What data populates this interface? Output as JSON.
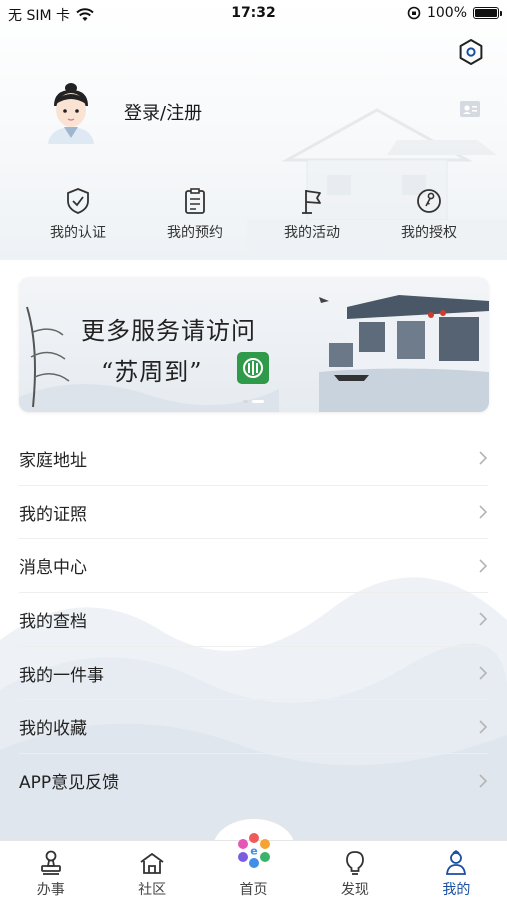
{
  "status_bar": {
    "carrier": "无 SIM 卡",
    "time": "17:32",
    "battery": "100%",
    "battery_level": 1.0
  },
  "profile": {
    "login_label": "登录/注册"
  },
  "quick_actions": [
    {
      "label": "我的认证",
      "icon": "shield-check-icon"
    },
    {
      "label": "我的预约",
      "icon": "clipboard-icon"
    },
    {
      "label": "我的活动",
      "icon": "flag-icon"
    },
    {
      "label": "我的授权",
      "icon": "key-icon"
    }
  ],
  "banner": {
    "line1": "更多服务请访问",
    "line2": "“苏周到”"
  },
  "menu": [
    {
      "label": "家庭地址"
    },
    {
      "label": "我的证照"
    },
    {
      "label": "消息中心"
    },
    {
      "label": "我的查档"
    },
    {
      "label": "我的一件事"
    },
    {
      "label": "我的收藏"
    },
    {
      "label": "APP意见反馈"
    }
  ],
  "tabs": [
    {
      "label": "办事",
      "icon": "stamp-icon"
    },
    {
      "label": "社区",
      "icon": "community-icon"
    },
    {
      "label": "首页",
      "icon": "home-logo-icon"
    },
    {
      "label": "发现",
      "icon": "lightbulb-icon"
    },
    {
      "label": "我的",
      "icon": "person-icon",
      "active": true
    }
  ],
  "colors": {
    "accent": "#1a4fa0",
    "logo_green": "#2f9a4a"
  }
}
